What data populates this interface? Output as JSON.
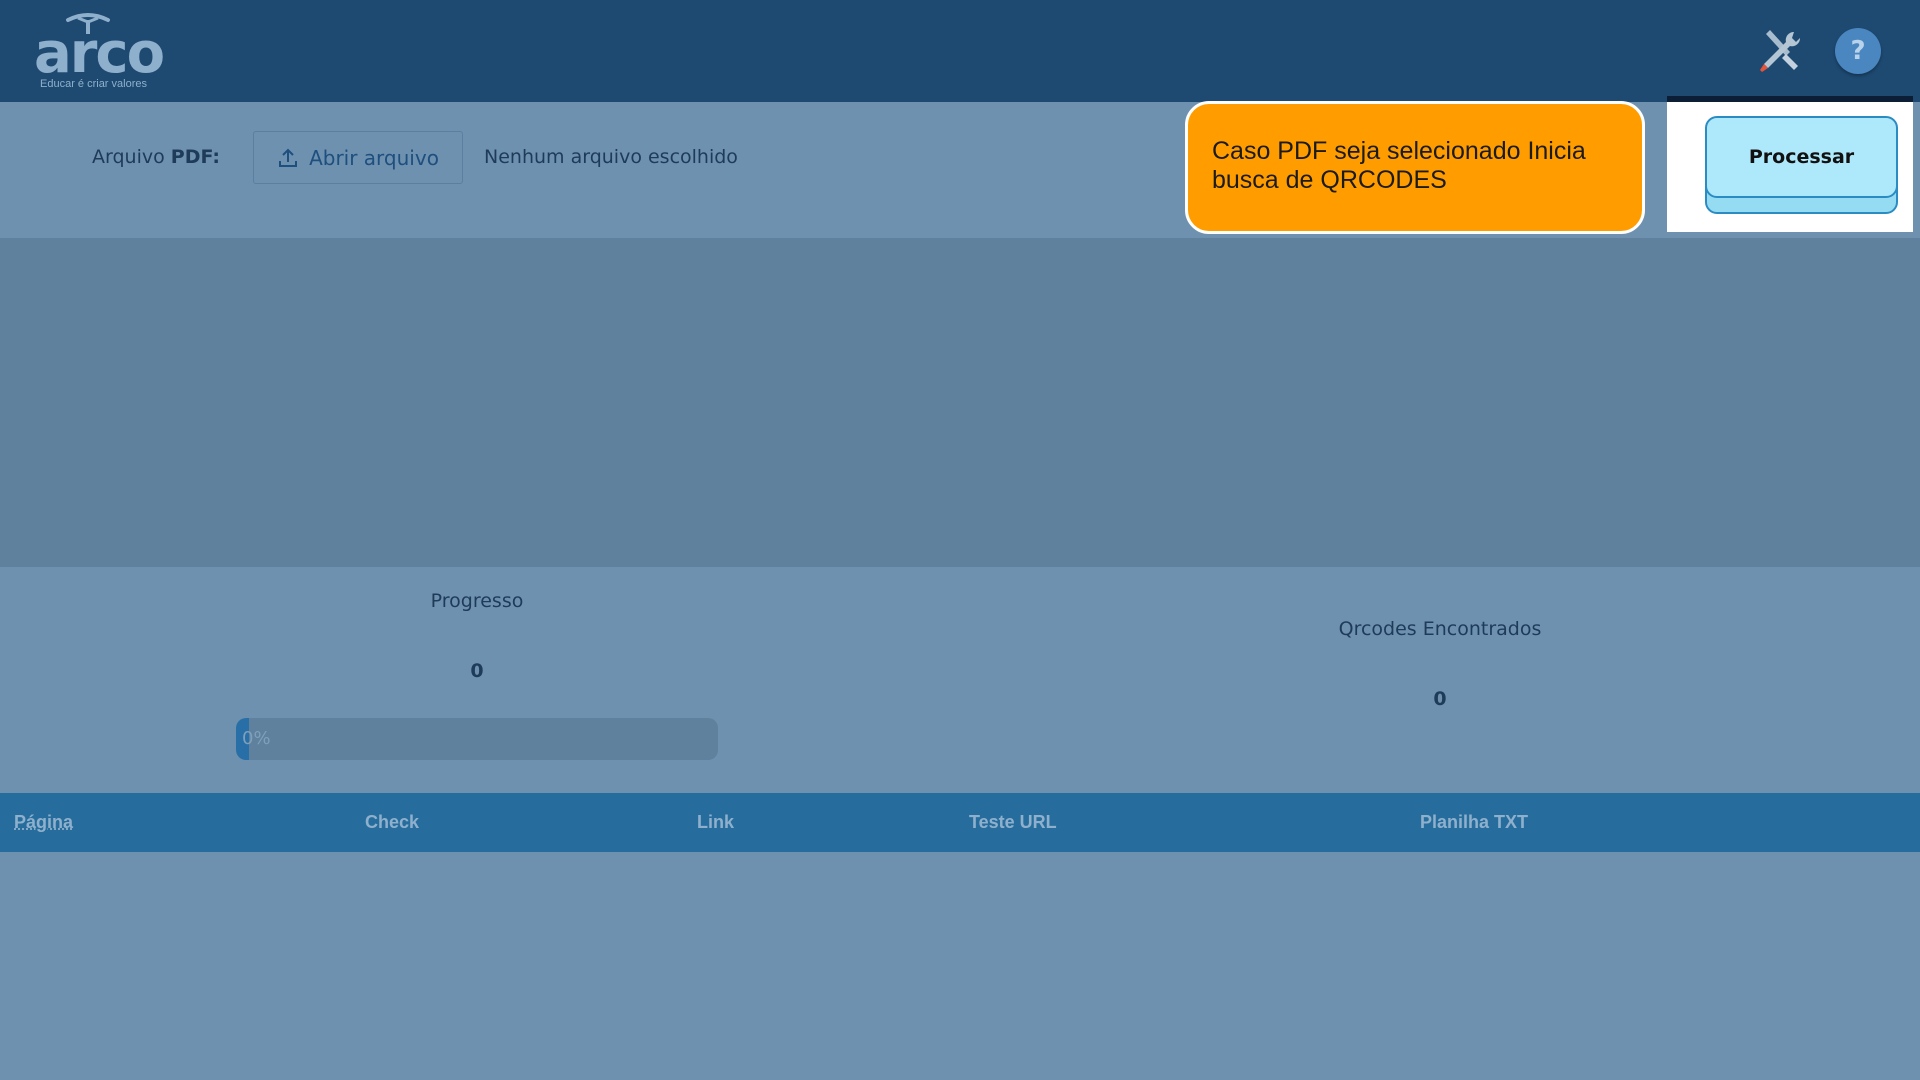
{
  "brand": {
    "logo_word": "arco",
    "tagline": "Educar é criar valores",
    "header_color": "#1e4a72"
  },
  "header": {
    "tools_icon": "tools-icon",
    "help_icon": "help-icon",
    "help_glyph": "?"
  },
  "file_picker": {
    "label_prefix": "Arquivo ",
    "label_bold": "PDF:",
    "open_button_label": "Abrir arquivo",
    "open_icon": "upload-icon",
    "status_text": "Nenhum arquivo escolhido"
  },
  "tooltip": {
    "text": "Caso PDF seja selecionado Inicia busca de QRCODES",
    "color": "#ff9d00"
  },
  "process_button": {
    "label": "Processar",
    "color": "#aee8fb"
  },
  "progress": {
    "title": "Progresso",
    "count": "0",
    "percent_label": "0%",
    "fraction": 0
  },
  "qrcodes": {
    "title": "Qrcodes Encontrados",
    "count": "0"
  },
  "table": {
    "columns": [
      "Página",
      "Check",
      "Link",
      "Teste URL",
      "Planilha TXT"
    ],
    "rows": []
  }
}
